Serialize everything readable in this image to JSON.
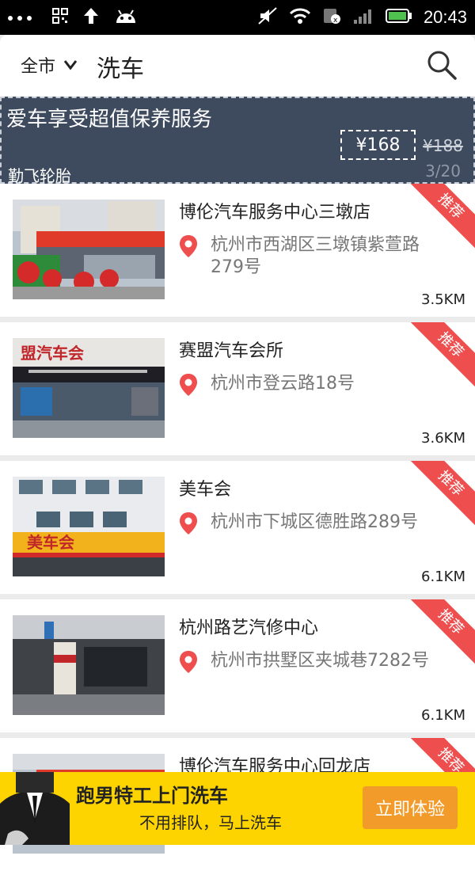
{
  "status": {
    "time": "20:43"
  },
  "header": {
    "city": "全市",
    "title": "洗车"
  },
  "banner": {
    "title": "爱车享受超值保养服务",
    "price": "¥168",
    "old_price": "¥188",
    "shop": "勤飞轮胎",
    "page": "3/20"
  },
  "shops": [
    {
      "name": "博伦汽车服务中心三墩店",
      "address": "杭州市西湖区三墩镇紫萱路279号",
      "distance": "3.5KM",
      "tag": "推荐"
    },
    {
      "name": "赛盟汽车会所",
      "address": "杭州市登云路18号",
      "distance": "3.6KM",
      "tag": "推荐"
    },
    {
      "name": "美车会",
      "address": "杭州市下城区德胜路289号",
      "distance": "6.1KM",
      "tag": "推荐"
    },
    {
      "name": "杭州路艺汽修中心",
      "address": "杭州市拱墅区夹城巷7282号",
      "distance": "6.1KM",
      "tag": "推荐"
    },
    {
      "name": "博伦汽车服务中心回龙店",
      "address": "",
      "distance": "",
      "tag": "推荐"
    }
  ],
  "ad": {
    "title": "跑男特工上门洗车",
    "subtitle": "不用排队，马上洗车",
    "button": "立即体验"
  }
}
